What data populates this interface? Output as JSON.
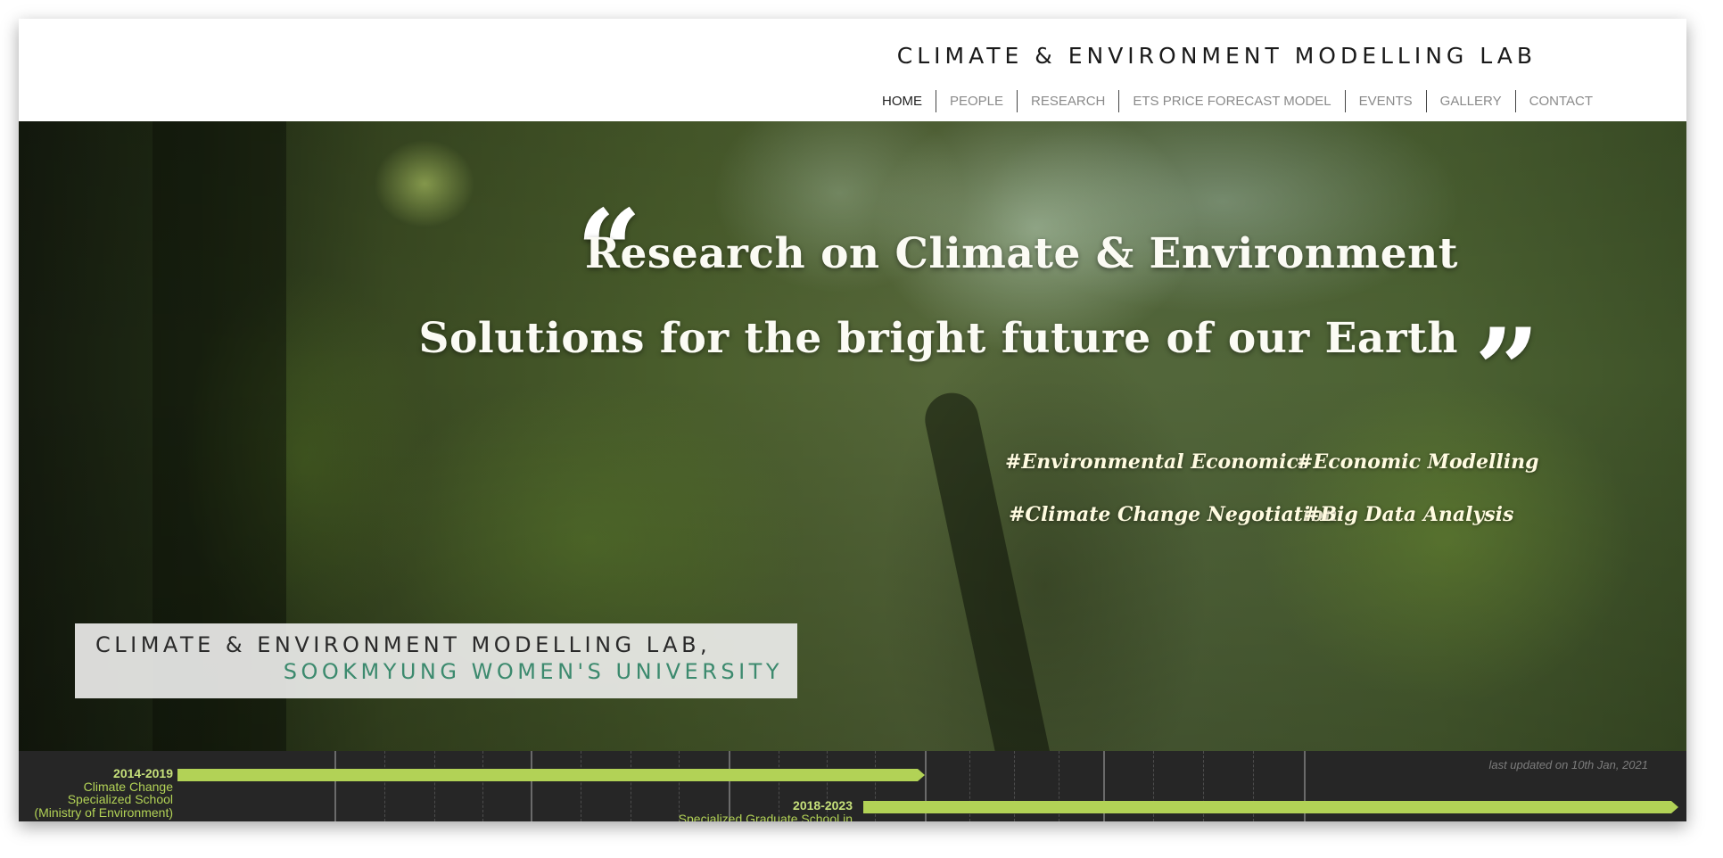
{
  "header": {
    "title": "CLIMATE & ENVIRONMENT MODELLING LAB",
    "nav": [
      {
        "label": "HOME"
      },
      {
        "label": "PEOPLE"
      },
      {
        "label": "RESEARCH"
      },
      {
        "label": "ETS PRICE FORECAST MODEL"
      },
      {
        "label": "EVENTS"
      },
      {
        "label": "GALLERY"
      },
      {
        "label": "CONTACT"
      }
    ],
    "active_item": "HOME"
  },
  "hero": {
    "quote_open": "“",
    "quote_close": "”",
    "headline_1": "Research on Climate & Environment",
    "headline_2": "Solutions for the bright future of our Earth",
    "tags": [
      "#Environmental Economics",
      "#Economic Modelling",
      "#Climate Change Negotiation",
      "#Big Data Analysis"
    ],
    "lab_box": {
      "name": "CLIMATE & ENVIRONMENT MODELLING LAB,",
      "university": "SOOKMYUNG WOMEN'S UNIVERSITY"
    }
  },
  "timeline": {
    "updated": "last updated on 10th Jan, 2021",
    "entries": [
      {
        "years": "2014-2019",
        "lines": [
          "Climate Change",
          "Specialized School",
          "(Ministry of Environment)"
        ]
      },
      {
        "years": "2018-2023",
        "lines": [
          "Specialized Graduate School in"
        ]
      }
    ]
  },
  "colors": {
    "accent_green": "#b2d256",
    "university_teal": "#3c8a6e",
    "timeline_bg": "#262626"
  }
}
